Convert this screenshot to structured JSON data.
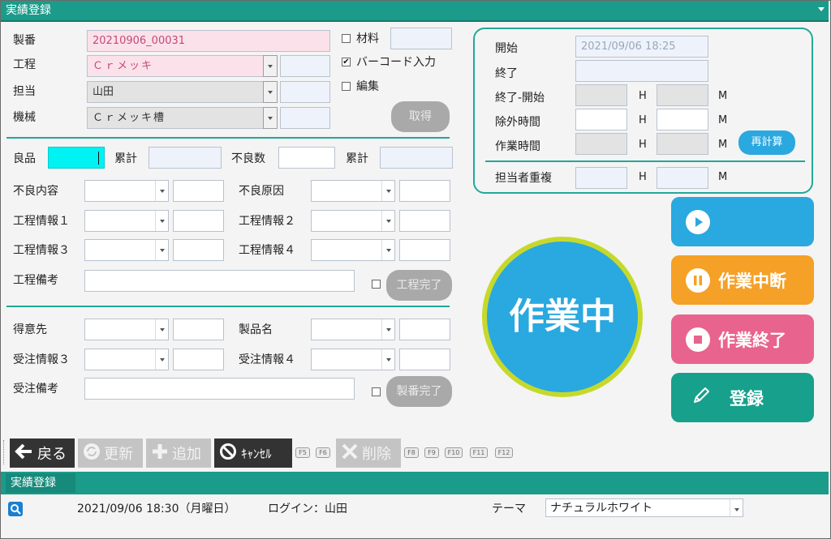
{
  "window": {
    "title": "実績登録"
  },
  "left": {
    "seiban_label": "製番",
    "seiban_value": "20210906_00031",
    "koutei_label": "工程",
    "koutei_value": "Ｃｒメッキ",
    "tantou_label": "担当",
    "tantou_value": "山田",
    "kikai_label": "機械",
    "kikai_value": "Ｃｒメッキ槽",
    "zairyo_label": "材料",
    "barcode_label": "バーコード入力",
    "henshu_label": "編集",
    "shutoku_label": "取得",
    "ryouhin_label": "良品",
    "ruikei_label": "累計",
    "furyousu_label": "不良数",
    "ruikei2_label": "累計",
    "furyou_naiyou_label": "不良内容",
    "furyou_genin_label": "不良原因",
    "koutei1_label": "工程情報１",
    "koutei2_label": "工程情報２",
    "koutei3_label": "工程情報３",
    "koutei4_label": "工程情報４",
    "koutei_bikou_label": "工程備考",
    "koutei_kanryo_label": "工程完了",
    "tokuisaki_label": "得意先",
    "seihinmei_label": "製品名",
    "juchu3_label": "受注情報３",
    "juchu4_label": "受注情報４",
    "juchu_bikou_label": "受注備考",
    "seiban_kanryo_label": "製番完了"
  },
  "time_panel": {
    "start_label": "開始",
    "start_value": "2021/09/06 18:25",
    "end_label": "終了",
    "diff_label": "終了-開始",
    "exclude_label": "除外時間",
    "work_label": "作業時間",
    "overlap_label": "担当者重複",
    "h_unit": "H",
    "m_unit": "M",
    "recalc_label": "再計算"
  },
  "status": {
    "label": "作業中"
  },
  "actions": {
    "pause_label": "作業中断",
    "end_label": "作業終了",
    "register_label": "登録"
  },
  "toolbar": {
    "back_label": "戻る",
    "update_label": "更新",
    "add_label": "追加",
    "cancel_label": "ｷｬﾝｾﾙ",
    "delete_label": "削除",
    "fkeys": [
      "F5",
      "F6",
      "F8",
      "F9",
      "F10",
      "F11",
      "F12"
    ]
  },
  "bottom": {
    "tab_label": "実績登録",
    "datetime": "2021/09/06 18:30（月曜日）",
    "login": "ログイン：山田",
    "theme_label": "テーマ",
    "theme_value": "ナチュラルホワイト"
  },
  "colors": {
    "accent": "#1b9b8a",
    "status_blue": "#2aa8e0",
    "status_ring": "#c6d92b",
    "pause_orange": "#f5a026",
    "end_pink": "#e8648e",
    "register_teal": "#17a08c"
  }
}
